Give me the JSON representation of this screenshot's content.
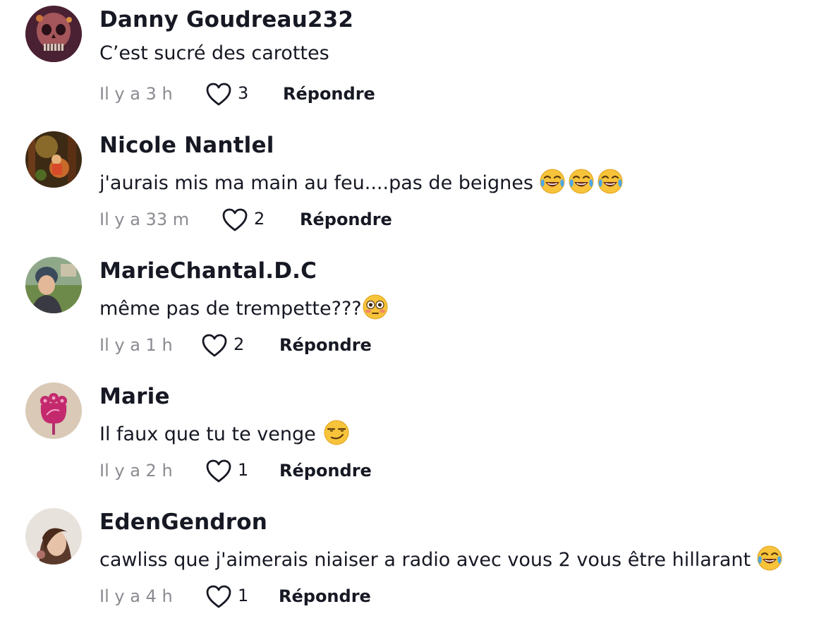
{
  "comments": [
    {
      "username": "Danny Goudreau232",
      "text": "C’est sucré des carottes",
      "emojis": [],
      "time": "Il y a 3 h",
      "likes": "3",
      "reply_label": "Répondre",
      "avatar_icon": "skull-avatar"
    },
    {
      "username": "Nicole Nantlel",
      "text": "j'aurais mis ma main au feu....pas de beignes",
      "emojis": [
        "tears-of-joy-emoji",
        "tears-of-joy-emoji",
        "tears-of-joy-emoji"
      ],
      "time": "Il y a 33 m",
      "likes": "2",
      "reply_label": "Répondre",
      "avatar_icon": "forest-avatar"
    },
    {
      "username": "MarieChantal.D.C",
      "text": "même pas de trempette???",
      "emojis": [
        "flushed-emoji"
      ],
      "time": "Il y a 1 h",
      "likes": "2",
      "reply_label": "Répondre",
      "avatar_icon": "person-outdoor-avatar"
    },
    {
      "username": "Marie",
      "text": "Il faux que tu te venge",
      "emojis": [
        "smirk-emoji"
      ],
      "time": "Il y a 2 h",
      "likes": "1",
      "reply_label": "Répondre",
      "avatar_icon": "flower-avatar"
    },
    {
      "username": "EdenGendron",
      "text": "cawliss que j'aimerais niaiser a radio avec vous 2 vous être hillarant",
      "emojis": [
        "tears-of-joy-emoji"
      ],
      "time": "Il y a 4 h",
      "likes": "1",
      "reply_label": "Répondre",
      "avatar_icon": "person-portrait-avatar"
    }
  ]
}
